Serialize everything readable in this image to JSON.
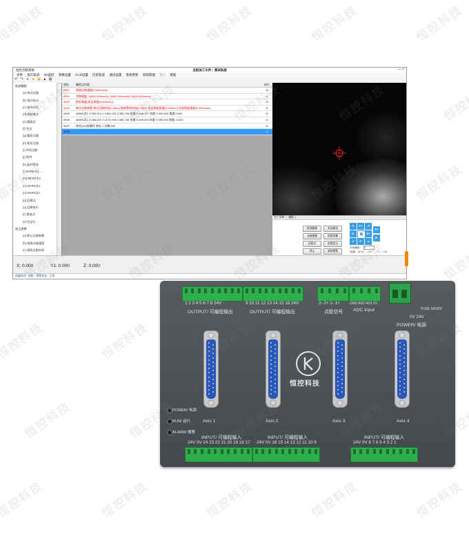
{
  "watermark": {
    "text": "恒控科技"
  },
  "window": {
    "app_name": "恒控点胶系统",
    "title": "当前加工文件：测试轨迹",
    "buttons": [
      "—",
      "×"
    ]
  },
  "menu": [
    "文件",
    "加工轨迹",
    "I/O监控",
    "参数设置",
    "CCD设置",
    "历史轨迹",
    "通讯设置",
    "系统更新",
    "权限管理",
    "语言",
    "帮助"
  ],
  "toolbar_icons": [
    "undo-icon",
    "redo-icon",
    "new-icon",
    "open-icon",
    "save-icon",
    "lock-icon",
    "unlock-icon"
  ],
  "tree": [
    {
      "label": "轨迹编程",
      "level": 0
    },
    {
      "label": "(a) 单点点胶",
      "level": 1
    },
    {
      "label": "(b) 线开始点",
      "level": 1
    },
    {
      "label": "(c) 线中间点",
      "level": 1
    },
    {
      "label": "(d) 线结束点",
      "level": 1
    },
    {
      "label": "(e) 圆弧点",
      "level": 1
    },
    {
      "label": "(f) 空点",
      "level": 1
    },
    {
      "label": "(g) 圆形点胶",
      "level": 1
    },
    {
      "label": "(h) 矩形点胶",
      "level": 1
    },
    {
      "label": "(i) 环形点胶",
      "level": 1
    },
    {
      "label": "(j) 阵列",
      "level": 1
    },
    {
      "label": "(k) 延时等待",
      "level": 1
    },
    {
      "label": "(l) MARK点1",
      "level": 1
    },
    {
      "label": "(m) MARK点2",
      "level": 1
    },
    {
      "label": "(n) MARK点3",
      "level": 1
    },
    {
      "label": "(o) MARK点4",
      "level": 1
    },
    {
      "label": "(p) 回原点",
      "level": 1
    },
    {
      "label": "(q) 回原执行",
      "level": 1
    },
    {
      "label": "(r) 基准点",
      "level": 1
    },
    {
      "label": "(s) 空运行",
      "level": 1
    },
    {
      "label": "加工参数",
      "level": 0
    },
    {
      "label": "(a) 默认点胶参数",
      "level": 1
    },
    {
      "label": "(b) 线段点胶速度",
      "level": 1
    },
    {
      "label": "(c) 线段点胶时间",
      "level": 1
    },
    {
      "label": "(d) 线段拉丝参数",
      "level": 1
    },
    {
      "label": "(e) 单点点胶参数",
      "level": 1
    },
    {
      "label": "(f) 提前关胶时间",
      "level": 1
    }
  ],
  "grid": {
    "headers": [
      "地址",
      "编程点内容",
      "执行"
    ],
    "rows": [
      {
        "no": "0001",
        "content": "线段点胶速度(5.000mm/s)",
        "red": true,
        "run": "☑"
      },
      {
        "no": "0002",
        "content": "空移速度: X(600.000mm/s) Y(600.000mm/s) Z(600.000mm/s)",
        "red": true,
        "run": "☑"
      },
      {
        "no": "0003",
        "content": "抬针高度(安全高度(5.000mm))",
        "red": true,
        "run": "☑"
      },
      {
        "no": "0004",
        "content": "单点点胶参数 单点点胶时间(0.300s) 结束等待时间(0.300s) 拉丝抬起高度(5.000mm) 拉丝抬起速度(5.000mm/s)",
        "red": true,
        "run": "☑"
      },
      {
        "no": "0005",
        "content": "MARK点1 X:168.013 Y:1366.120 Z:385.708 灰度:X:548.027 灰度:Y:409.620 角度:0.000",
        "red": false,
        "run": "☑"
      },
      {
        "no": "0006",
        "content": "MARK点2 X:168.020 Y:1172.008 Z:385.708 灰度:X:485.000 灰度:Y:553.000 角度:-0.022",
        "red": false,
        "run": "☑"
      },
      {
        "no": "0007",
        "content": "阵列(1D)阵循环 地址:1 次数:000",
        "red": false,
        "run": "☑"
      },
      {
        "no": "0008",
        "content": "",
        "red": false,
        "run": "☐",
        "selected": true
      }
    ]
  },
  "camera": {
    "tabs": [
      "加工图像",
      "相机"
    ]
  },
  "controls": {
    "buttons": [
      "检测图像",
      "关闭相机",
      "动态图像",
      "抓图采集",
      "回原点",
      "拍照定位",
      "停止",
      "清除报警"
    ],
    "jog": [
      "X-",
      "Y+",
      "Y-",
      "X+",
      "Z+",
      "Z-",
      "快"
    ],
    "speed_label": "手动速度",
    "speed_value": "5",
    "step_options": [
      "连续",
      "0.01",
      "0.1",
      "1",
      "10"
    ]
  },
  "coords": {
    "x": "X: 0.000",
    "y": "Y1: 0.000",
    "z": "Z: 0.000"
  },
  "status": [
    "机器状态：待机",
    "报警状态：正常"
  ],
  "device": {
    "output1_label": "OUTPUT/ 可编程输出",
    "output2_label": "OUTPUT/ 可编程输出",
    "output1_pins": "1  2  3  4  5  6  7  8  24V",
    "output2_pins": "9 10 11 12 13 14 15 16 24V",
    "dispense_pins": "2-  2+  1-  1+",
    "dispense_label": "点胶信号",
    "adc_pins": "GND AD2 AD1 5V",
    "adc_label": "ADC input",
    "power_pins": "0V  24V",
    "fuse_label": "FUSE  5A/30V",
    "power_label": "POWER/ 电源",
    "axes": [
      "Axis 1",
      "Axis 2",
      "Axis 3",
      "Axis 4"
    ],
    "logo_text": "恒控科技",
    "leds": [
      "POWER/ 电源",
      "RUN/ 运行",
      "ALARM/ 报警"
    ],
    "input_labels": [
      "INPUT/ 可编程输入",
      "INPUT/ 可编程输入",
      "INPUT/ 可编程输入"
    ],
    "input1_pins": "24V  0V  24 23 22 21 20 19 18 17",
    "input2_pins": "24V  0V  16 15 14 13 12 11 10  9",
    "input3_pins": "24V  0V   8  7  6  5  4  3  2  1"
  }
}
